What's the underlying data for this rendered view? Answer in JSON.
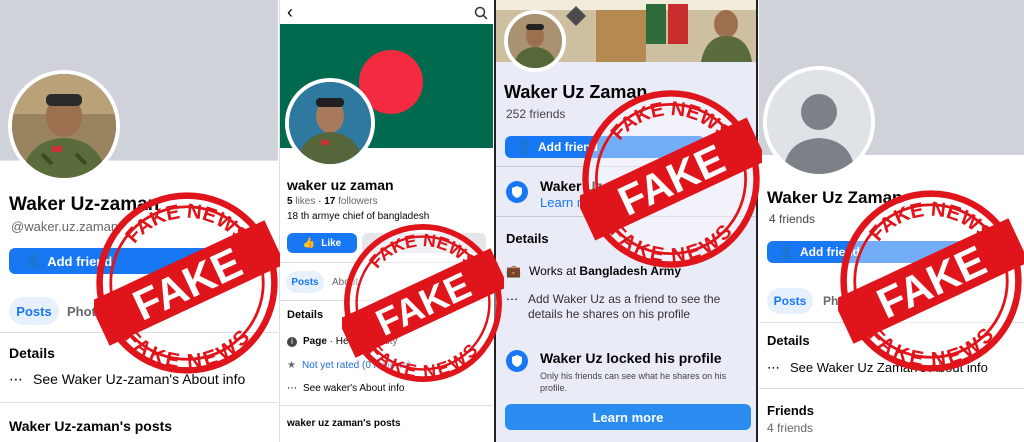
{
  "panel1": {
    "name": "Waker Uz-zaman",
    "username": "@waker.uz.zaman",
    "add_friend": "Add friend",
    "tab_posts": "Posts",
    "tab_photos": "Photos",
    "details_heading": "Details",
    "see_about": "See Waker Uz-zaman's About info",
    "posts_heading": "Waker Uz-zaman's posts"
  },
  "panel2": {
    "name": "waker uz zaman",
    "likes_count": "5",
    "likes_label": "likes",
    "followers_count": "17",
    "followers_label": "followers",
    "bio": "18 th armye chief of bangladesh",
    "like_button": "Like",
    "tab_posts": "Posts",
    "tab_about": "About",
    "details_heading": "Details",
    "page_label": "Page",
    "page_category": "Health/beauty",
    "rating": "Not yet rated (0 reviews)",
    "see_about": "See waker's About info",
    "posts_heading": "waker uz zaman's posts"
  },
  "panel3": {
    "name": "Waker Uz Zaman",
    "friends": "252 friends",
    "add_friend": "Add friend",
    "lock_name": "Waker Uz",
    "learn_more_link": "Learn more",
    "details_heading": "Details",
    "works_at_prefix": "Works at",
    "works_at_org": "Bangladesh Army",
    "add_friend_info": "Add Waker Uz as a friend to see the details he shares on his profile",
    "locked_title": "Waker Uz locked his profile",
    "locked_body": "Only his friends can see what he shares on his profile.",
    "learn_more_button": "Learn more"
  },
  "panel4": {
    "name": "Waker Uz Zaman",
    "friends": "4 friends",
    "add_friend": "Add friend",
    "tab_posts": "Posts",
    "tab_photos": "Photos",
    "details_heading": "Details",
    "see_about": "See Waker Uz Zaman's About info",
    "friends_heading": "Friends",
    "friends_count": "4 friends"
  },
  "stamp": {
    "top_text": "FAKE NEWS",
    "main_text": "FAKE",
    "bottom_text": "FAKE NEWS",
    "color": "#e0141b"
  },
  "colors": {
    "facebook_blue": "#1877f2",
    "bangladesh_green": "#006a4e",
    "bangladesh_red": "#f42a41",
    "cover_grey": "#cfd3d9"
  }
}
